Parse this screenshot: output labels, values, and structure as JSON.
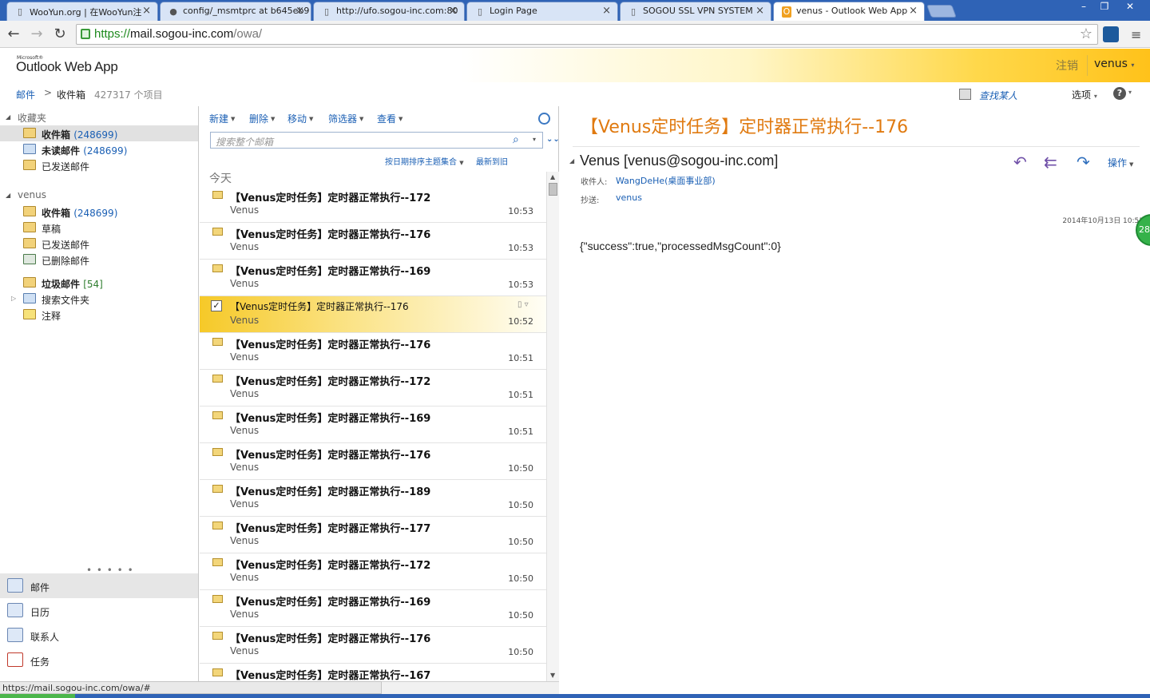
{
  "browser": {
    "tabs": [
      {
        "title": "WooYun.org | 在WooYun注",
        "icon": "page-icon"
      },
      {
        "title": "config/_msmtprc at b645eb9",
        "icon": "github-icon"
      },
      {
        "title": "http://ufo.sogou-inc.com:80",
        "icon": "page-icon"
      },
      {
        "title": "Login Page",
        "icon": "page-icon"
      },
      {
        "title": "SOGOU SSL VPN SYSTEM",
        "icon": "page-icon"
      },
      {
        "title": "venus - Outlook Web App",
        "icon": "outlook-icon"
      }
    ],
    "url": {
      "scheme": "https://",
      "host": "mail.sogou-inc.com",
      "path": "/owa/"
    },
    "status_url": "https://mail.sogou-inc.com/owa/#"
  },
  "header": {
    "logo_small": "Microsoft®",
    "logo": "Outlook Web App",
    "signout": "注销",
    "username": "venus"
  },
  "breadcrumb": {
    "mail": "邮件",
    "separator": ">",
    "folder": "收件箱",
    "count": "427317 个项目",
    "find_contact": "查找某人",
    "options": "选项"
  },
  "nav": {
    "favorites_title": "收藏夹",
    "favorites": [
      {
        "label": "收件箱",
        "count": "(248699)",
        "bold": true
      },
      {
        "label": "未读邮件",
        "count": "(248699)",
        "bold": true
      },
      {
        "label": "已发送邮件",
        "count": "",
        "bold": false
      }
    ],
    "mailbox_title": "venus",
    "mailbox": [
      {
        "label": "收件箱",
        "count": "(248699)",
        "bold": true
      },
      {
        "label": "草稿",
        "count": "",
        "bold": false
      },
      {
        "label": "已发送邮件",
        "count": "",
        "bold": false
      },
      {
        "label": "已删除邮件",
        "count": "",
        "bold": false
      },
      {
        "label": "垃圾邮件",
        "count": "[54]",
        "bold": true
      },
      {
        "label": "搜索文件夹",
        "count": "",
        "bold": false
      },
      {
        "label": "注释",
        "count": "",
        "bold": false
      }
    ],
    "dots": "• • • • •",
    "modules": [
      {
        "label": "邮件",
        "icon": "mail-icon"
      },
      {
        "label": "日历",
        "icon": "calendar-icon"
      },
      {
        "label": "联系人",
        "icon": "contacts-icon"
      },
      {
        "label": "任务",
        "icon": "tasks-icon"
      }
    ]
  },
  "list": {
    "toolbar": {
      "new": "新建",
      "delete": "删除",
      "move": "移动",
      "filter": "筛选器",
      "view": "查看"
    },
    "search_placeholder": "搜索整个邮箱",
    "sort_conversation": "按日期排序主题集合",
    "sort_date": "最新到旧",
    "group_label": "今天",
    "messages": [
      {
        "subject": "【Venus定时任务】定时器正常执行--172",
        "sender": "Venus",
        "time": "10:53"
      },
      {
        "subject": "【Venus定时任务】定时器正常执行--176",
        "sender": "Venus",
        "time": "10:53"
      },
      {
        "subject": "【Venus定时任务】定时器正常执行--169",
        "sender": "Venus",
        "time": "10:53"
      },
      {
        "subject": "【Venus定时任务】定时器正常执行--176",
        "sender": "Venus",
        "time": "10:52",
        "selected": true
      },
      {
        "subject": "【Venus定时任务】定时器正常执行--176",
        "sender": "Venus",
        "time": "10:51"
      },
      {
        "subject": "【Venus定时任务】定时器正常执行--172",
        "sender": "Venus",
        "time": "10:51"
      },
      {
        "subject": "【Venus定时任务】定时器正常执行--169",
        "sender": "Venus",
        "time": "10:51"
      },
      {
        "subject": "【Venus定时任务】定时器正常执行--176",
        "sender": "Venus",
        "time": "10:50"
      },
      {
        "subject": "【Venus定时任务】定时器正常执行--189",
        "sender": "Venus",
        "time": "10:50"
      },
      {
        "subject": "【Venus定时任务】定时器正常执行--177",
        "sender": "Venus",
        "time": "10:50"
      },
      {
        "subject": "【Venus定时任务】定时器正常执行--172",
        "sender": "Venus",
        "time": "10:50"
      },
      {
        "subject": "【Venus定时任务】定时器正常执行--169",
        "sender": "Venus",
        "time": "10:50"
      },
      {
        "subject": "【Venus定时任务】定时器正常执行--176",
        "sender": "Venus",
        "time": "10:50"
      },
      {
        "subject": "【Venus定时任务】定时器正常执行--167",
        "sender": "Venus",
        "time": "10:50"
      }
    ]
  },
  "reading": {
    "subject": "【Venus定时任务】定时器正常执行--176",
    "from": "Venus [venus@sogou-inc.com]",
    "to_label": "收件人:",
    "to": "WangDeHe(桌面事业部)",
    "cc_label": "抄送:",
    "cc": "venus",
    "date": "2014年10月13日 10:52",
    "body": "{\"success\":true,\"processedMsgCount\":0}",
    "actions_label": "操作",
    "badge": "28"
  },
  "colors": {
    "accent": "#1a5fb4",
    "subject_orange": "#e07a10",
    "header_yellow": "#ffc21a",
    "selected_row": "#f6c928"
  }
}
